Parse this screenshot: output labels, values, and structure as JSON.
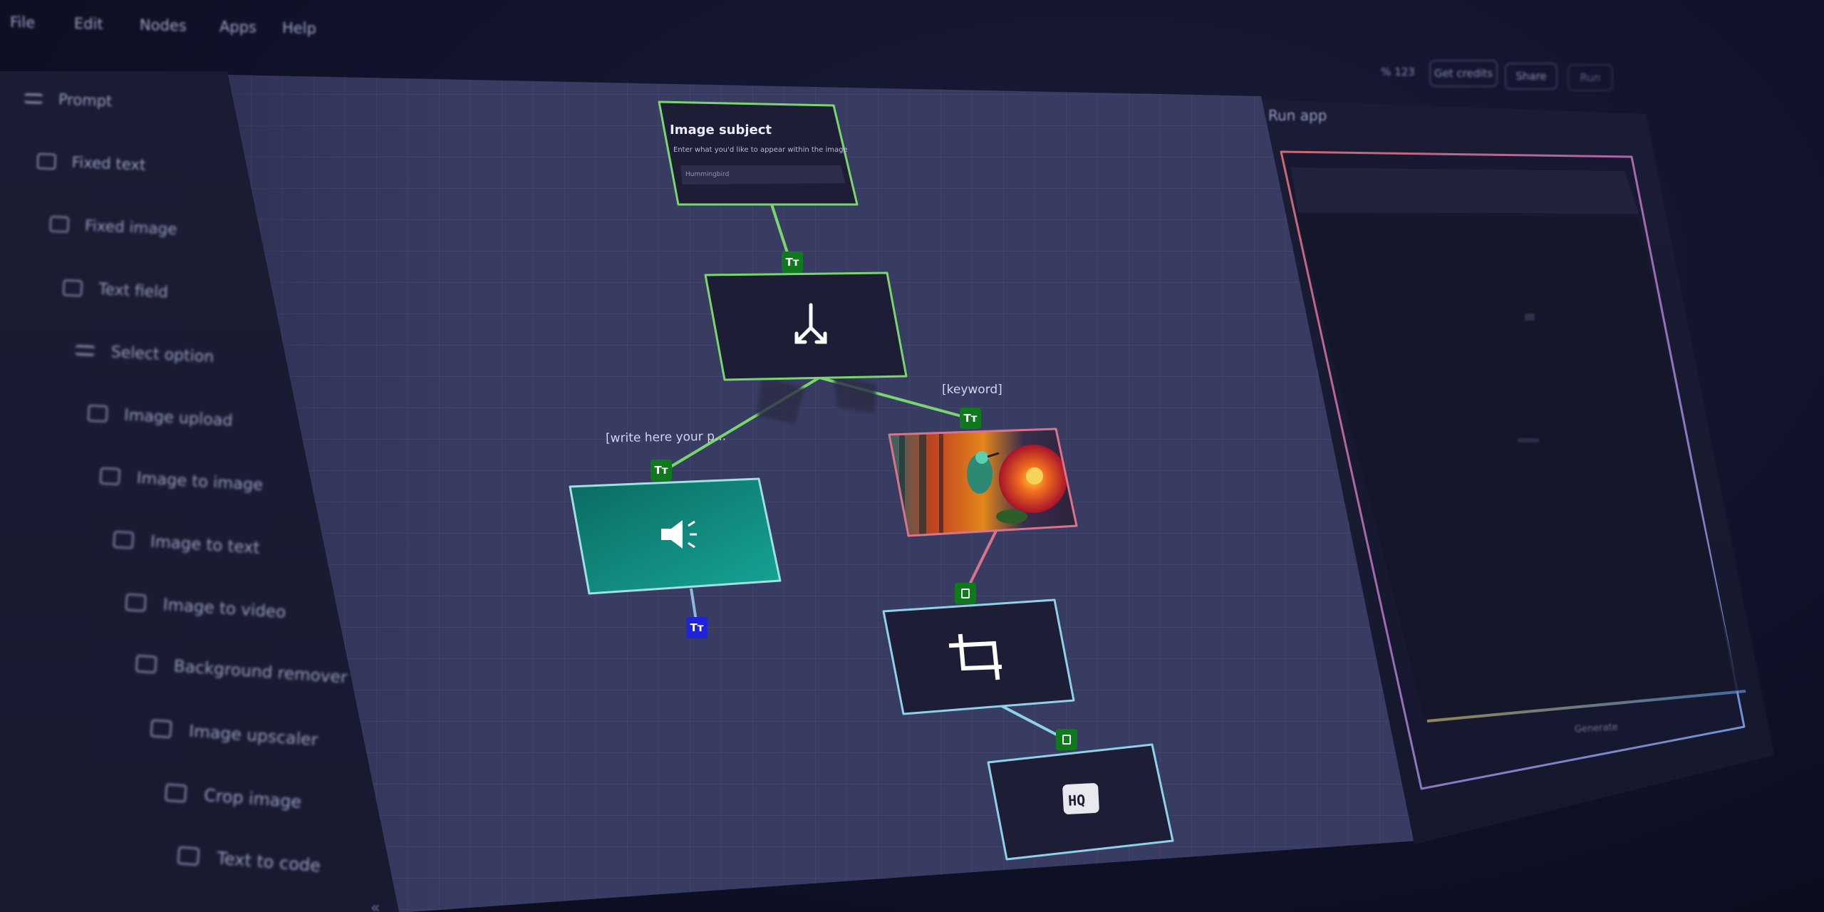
{
  "menu": [
    "File",
    "Edit",
    "Nodes",
    "Apps",
    "Help"
  ],
  "toolbar": {
    "zoom": "% 123",
    "buttons": [
      "Get credits",
      "Share",
      "Run"
    ]
  },
  "sidebar": {
    "items": [
      {
        "label": "Prompt",
        "icon": "list-icon"
      },
      {
        "label": "Fixed text",
        "icon": "text-icon"
      },
      {
        "label": "Fixed image",
        "icon": "image-icon"
      },
      {
        "label": "Text field",
        "icon": "text-field-icon"
      },
      {
        "label": "Select option",
        "icon": "sliders-icon"
      },
      {
        "label": "Image upload",
        "icon": "upload-icon"
      },
      {
        "label": "Image to image",
        "icon": "image-to-image-icon"
      },
      {
        "label": "Image to text",
        "icon": "image-to-text-icon"
      },
      {
        "label": "Image to video",
        "icon": "video-icon"
      },
      {
        "label": "Background remover",
        "icon": "background-remove-icon"
      },
      {
        "label": "Image upscaler",
        "icon": "upscale-icon"
      },
      {
        "label": "Crop image",
        "icon": "crop-icon"
      },
      {
        "label": "Text to code",
        "icon": "code-icon"
      }
    ]
  },
  "nodes": {
    "subject": {
      "title": "Image subject",
      "description": "Enter what you'd like to appear within the image",
      "placeholder": "Hummingbird"
    },
    "split_label_left": "[write here your p...",
    "split_label_right": "[keyword]"
  },
  "ports": {
    "text": "Tт"
  },
  "run_panel": {
    "title": "Run app",
    "footer": "Generate"
  },
  "colors": {
    "canvas": "#383b62",
    "node_bg": "#1c1d35",
    "green_edge": "#7ad66c",
    "teal": "#13a394",
    "pink_edge": "#d9738a",
    "light_blue_edge": "#8fd1e8",
    "port_green": "#0f7a1c",
    "port_blue": "#1e22d8"
  }
}
